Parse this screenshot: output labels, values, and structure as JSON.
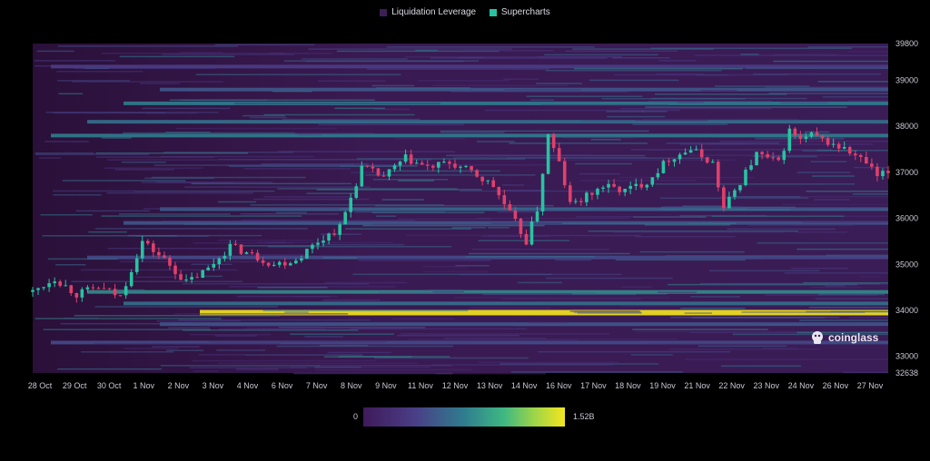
{
  "legend": [
    {
      "label": "Liquidation Leverage",
      "color": "#3d1f58"
    },
    {
      "label": "Supercharts",
      "color": "#27c4a0"
    }
  ],
  "watermark": {
    "text": "coinglass",
    "icon": "coinglass-logo-icon"
  },
  "colorbar": {
    "min_label": "0",
    "max_label": "1.52B",
    "colors": [
      "#3f1a5a",
      "#4a3d86",
      "#2f7d8e",
      "#3fb883",
      "#9ed548",
      "#f4e61e"
    ]
  },
  "chart_data": {
    "type": "heatmap",
    "x_labels": [
      "28 Oct",
      "29 Oct",
      "30 Oct",
      "1 Nov",
      "2 Nov",
      "3 Nov",
      "4 Nov",
      "6 Nov",
      "7 Nov",
      "8 Nov",
      "9 Nov",
      "11 Nov",
      "12 Nov",
      "13 Nov",
      "14 Nov",
      "16 Nov",
      "17 Nov",
      "18 Nov",
      "19 Nov",
      "21 Nov",
      "22 Nov",
      "23 Nov",
      "24 Nov",
      "26 Nov",
      "27 Nov"
    ],
    "y_ticks": [
      32638,
      33000,
      34000,
      35000,
      36000,
      37000,
      38000,
      39000,
      39800
    ],
    "ylim": [
      32638,
      39800
    ],
    "colorscale_max": 1.52,
    "price_path": [
      [
        0,
        34400
      ],
      [
        4,
        34700
      ],
      [
        8,
        34350
      ],
      [
        12,
        34500
      ],
      [
        16,
        34300
      ],
      [
        20,
        35500
      ],
      [
        24,
        35100
      ],
      [
        28,
        34600
      ],
      [
        32,
        34900
      ],
      [
        36,
        35400
      ],
      [
        40,
        35200
      ],
      [
        44,
        35000
      ],
      [
        48,
        35100
      ],
      [
        52,
        35500
      ],
      [
        56,
        35800
      ],
      [
        60,
        37100
      ],
      [
        64,
        36900
      ],
      [
        68,
        37300
      ],
      [
        72,
        37100
      ],
      [
        76,
        37200
      ],
      [
        80,
        37000
      ],
      [
        84,
        36700
      ],
      [
        88,
        35900
      ],
      [
        90,
        35500
      ],
      [
        92,
        36200
      ],
      [
        94,
        37800
      ],
      [
        96,
        37200
      ],
      [
        98,
        36300
      ],
      [
        100,
        36400
      ],
      [
        104,
        36700
      ],
      [
        108,
        36600
      ],
      [
        112,
        36800
      ],
      [
        116,
        37300
      ],
      [
        120,
        37500
      ],
      [
        124,
        37200
      ],
      [
        126,
        36200
      ],
      [
        128,
        36600
      ],
      [
        132,
        37400
      ],
      [
        136,
        37200
      ],
      [
        138,
        37900
      ],
      [
        140,
        37700
      ],
      [
        142,
        37800
      ],
      [
        144,
        37700
      ],
      [
        148,
        37500
      ],
      [
        152,
        37200
      ],
      [
        154,
        36900
      ],
      [
        156,
        37000
      ]
    ],
    "liquidation_bands": [
      {
        "price": 33950,
        "intensity": 1.0
      },
      {
        "price": 34400,
        "intensity": 0.55
      },
      {
        "price": 34150,
        "intensity": 0.45
      },
      {
        "price": 33700,
        "intensity": 0.35
      },
      {
        "price": 33300,
        "intensity": 0.3
      },
      {
        "price": 35150,
        "intensity": 0.3
      },
      {
        "price": 35900,
        "intensity": 0.35
      },
      {
        "price": 36200,
        "intensity": 0.4
      },
      {
        "price": 37800,
        "intensity": 0.5
      },
      {
        "price": 38100,
        "intensity": 0.45
      },
      {
        "price": 38500,
        "intensity": 0.5
      },
      {
        "price": 38800,
        "intensity": 0.35
      },
      {
        "price": 39300,
        "intensity": 0.25
      }
    ]
  }
}
